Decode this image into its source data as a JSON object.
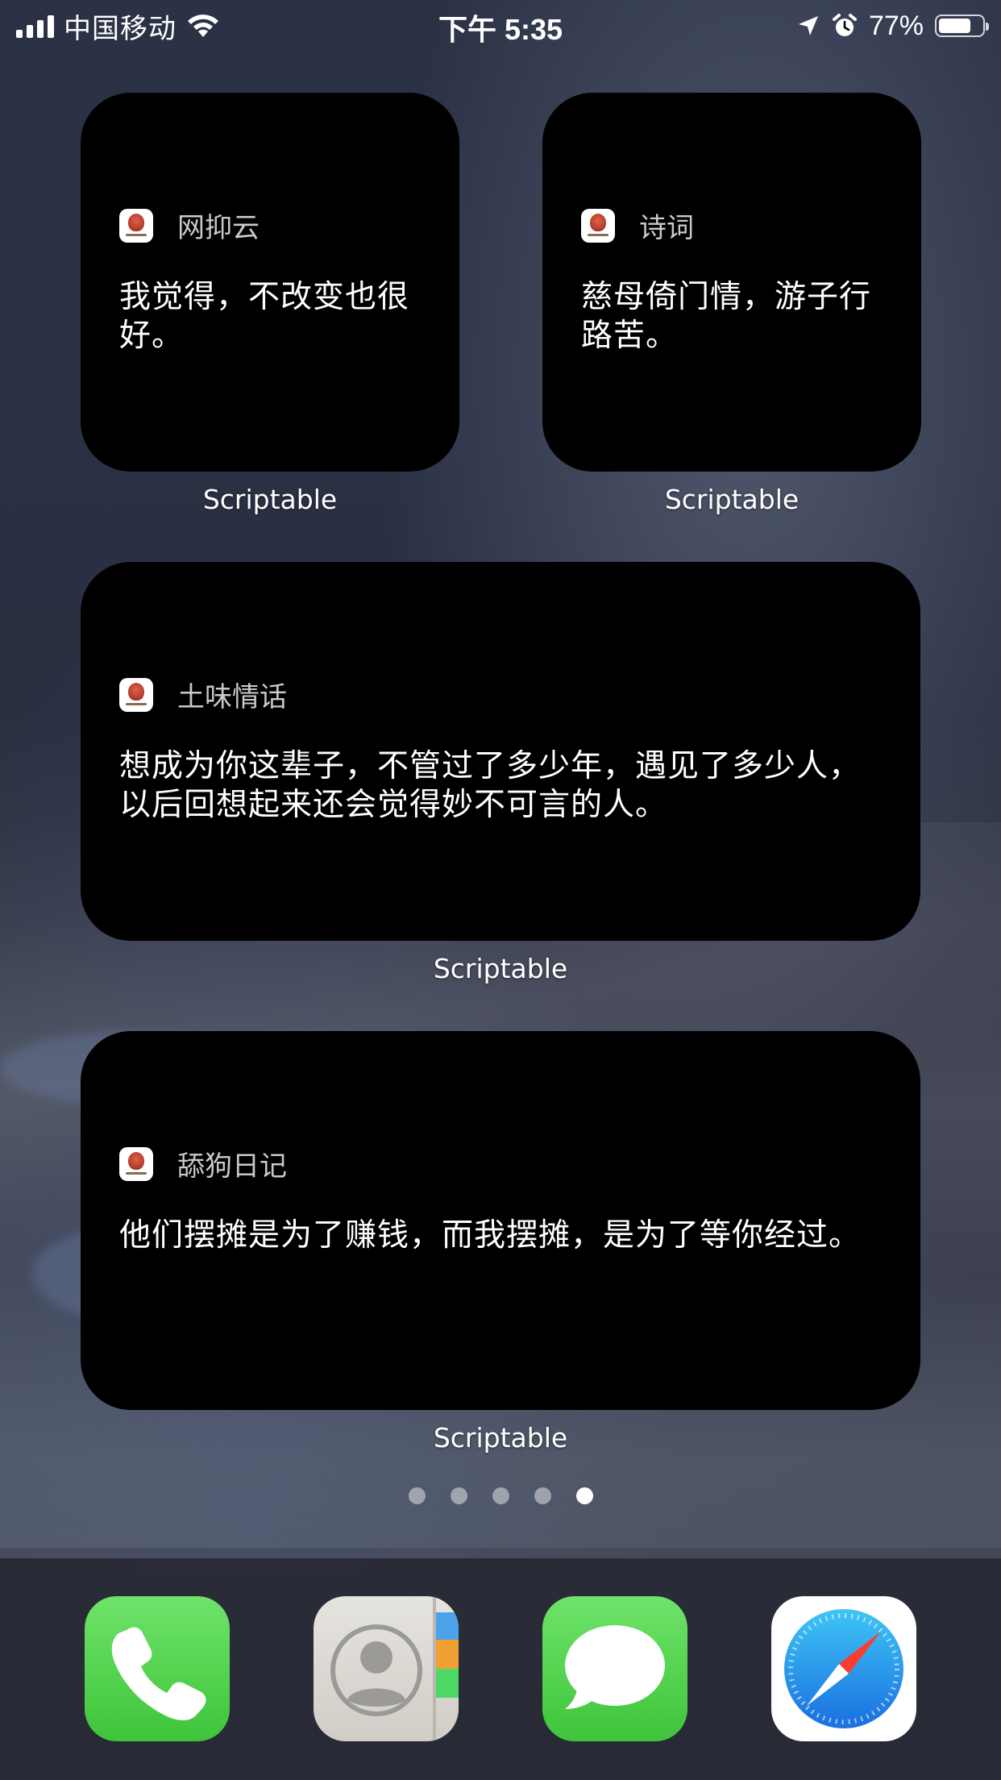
{
  "status_bar": {
    "carrier": "中国移动",
    "time": "下午 5:35",
    "battery_percent": "77%",
    "battery_level": 0.77,
    "icons": [
      "signal-icon",
      "wifi-icon",
      "location-icon",
      "alarm-icon",
      "battery-icon"
    ]
  },
  "widgets": [
    {
      "title": "网抑云",
      "text": "我觉得，不改变也很好。",
      "label": "Scriptable",
      "size": "small"
    },
    {
      "title": "诗词",
      "text": "慈母倚门情，游子行路苦。",
      "label": "Scriptable",
      "size": "small"
    },
    {
      "title": "土味情话",
      "text": "想成为你这辈子，不管过了多少年，遇见了多少人，以后回想起来还会觉得妙不可言的人。",
      "label": "Scriptable",
      "size": "medium"
    },
    {
      "title": "舔狗日记",
      "text": "他们摆摊是为了赚钱，而我摆摊，是为了等你经过。",
      "label": "Scriptable",
      "size": "medium"
    }
  ],
  "page_indicator": {
    "page_count": 5,
    "current_page": 5
  },
  "dock": {
    "apps": [
      {
        "name": "phone",
        "icon": "phone-icon"
      },
      {
        "name": "contacts",
        "icon": "contacts-icon"
      },
      {
        "name": "messages",
        "icon": "messages-icon"
      },
      {
        "name": "safari",
        "icon": "compass-icon"
      }
    ]
  },
  "colors": {
    "widget_bg": "#000000",
    "widget_title": "#c9c9ce",
    "dock_green": "#4cd964"
  }
}
